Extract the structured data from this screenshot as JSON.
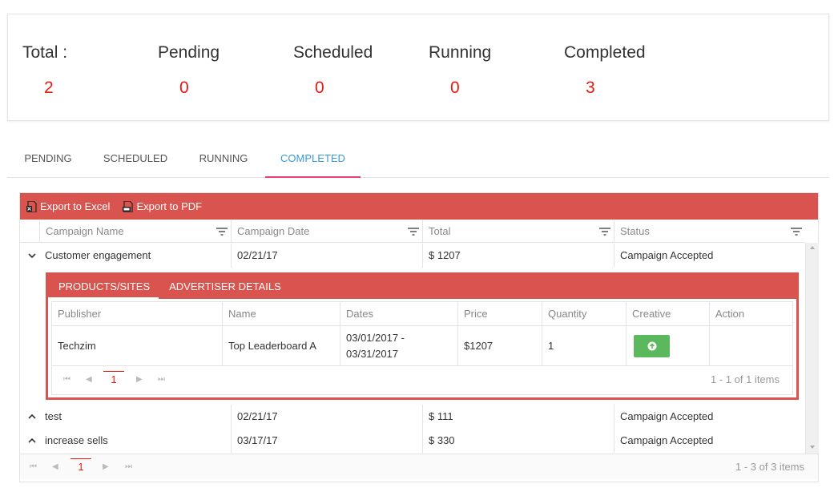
{
  "stats": {
    "total_label": "Total :",
    "total_value": "2",
    "pending_label": "Pending",
    "pending_value": "0",
    "scheduled_label": "Scheduled",
    "scheduled_value": "0",
    "running_label": "Running",
    "running_value": "0",
    "completed_label": "Completed",
    "completed_value": "3"
  },
  "tabs": [
    "PENDING",
    "SCHEDULED",
    "RUNNING",
    "COMPLETED"
  ],
  "toolbar": {
    "export_excel": "Export to Excel",
    "export_pdf": "Export to PDF"
  },
  "columns": [
    "Campaign Name",
    "Campaign Date",
    "Total",
    "Status"
  ],
  "rows": [
    {
      "name": "Customer engagement",
      "date": "02/21/17",
      "total": "$ 1207",
      "status": "Campaign Accepted",
      "expanded": true
    },
    {
      "name": "test",
      "date": "02/21/17",
      "total": "$ 111",
      "status": "Campaign Accepted",
      "expanded": false
    },
    {
      "name": "increase sells",
      "date": "03/17/17",
      "total": "$ 330",
      "status": "Campaign Accepted",
      "expanded": false
    }
  ],
  "detail": {
    "tabs": [
      "PRODUCTS/SITES",
      "ADVERTISER DETAILS"
    ],
    "columns": [
      "Publisher",
      "Name",
      "Dates",
      "Price",
      "Quantity",
      "Creative",
      "Action"
    ],
    "row": {
      "publisher": "Techzim",
      "name": "Top Leaderboard A",
      "dates_line1": "03/01/2017 -",
      "dates_line2": "03/31/2017",
      "price": "$1207",
      "quantity": "1"
    },
    "pager": {
      "page": "1",
      "info": "1 - 1 of 1 items"
    }
  },
  "pager": {
    "page": "1",
    "info": "1 - 3 of 3 items"
  },
  "colors": {
    "accent_red": "#d9534f",
    "value_red": "#e8190d",
    "tab_active": "#3a9ad9",
    "tab_underline": "#e83f7a",
    "upload_green": "#5cb85c"
  }
}
